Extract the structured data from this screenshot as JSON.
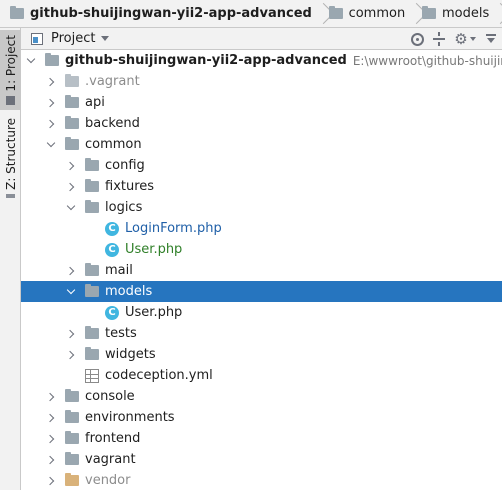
{
  "breadcrumb": {
    "items": [
      {
        "label": "github-shuijingwan-yii2-app-advanced",
        "bold": true
      },
      {
        "label": "common",
        "bold": false
      },
      {
        "label": "models",
        "bold": false
      }
    ]
  },
  "side_tabs": {
    "project": "1: Project",
    "structure": "Z: Structure"
  },
  "tool_window": {
    "view_label": "Project",
    "actions": [
      "locate-target",
      "collapse-all",
      "settings",
      "hide"
    ]
  },
  "tree": [
    {
      "label": "github-shuijingwan-yii2-app-advanced",
      "path": "E:\\wwwroot\\github-shuijingwan-",
      "depth": 0,
      "expanded": true,
      "icon": "folder",
      "style": "root"
    },
    {
      "label": ".vagrant",
      "depth": 1,
      "expanded": false,
      "icon": "folder-dim",
      "style": "dim"
    },
    {
      "label": "api",
      "depth": 1,
      "expanded": false,
      "icon": "folder",
      "style": "normal"
    },
    {
      "label": "backend",
      "depth": 1,
      "expanded": false,
      "icon": "folder",
      "style": "normal"
    },
    {
      "label": "common",
      "depth": 1,
      "expanded": true,
      "icon": "folder",
      "style": "normal"
    },
    {
      "label": "config",
      "depth": 2,
      "expanded": false,
      "icon": "folder",
      "style": "normal"
    },
    {
      "label": "fixtures",
      "depth": 2,
      "expanded": false,
      "icon": "folder",
      "style": "normal"
    },
    {
      "label": "logics",
      "depth": 2,
      "expanded": true,
      "icon": "folder",
      "style": "normal"
    },
    {
      "label": "LoginForm.php",
      "depth": 3,
      "expanded": null,
      "icon": "php-class",
      "style": "blue"
    },
    {
      "label": "User.php",
      "depth": 3,
      "expanded": null,
      "icon": "php-class",
      "style": "green"
    },
    {
      "label": "mail",
      "depth": 2,
      "expanded": false,
      "icon": "folder",
      "style": "normal"
    },
    {
      "label": "models",
      "depth": 2,
      "expanded": true,
      "icon": "folder",
      "style": "normal",
      "selected": true
    },
    {
      "label": "User.php",
      "depth": 3,
      "expanded": null,
      "icon": "php-class",
      "style": "normal"
    },
    {
      "label": "tests",
      "depth": 2,
      "expanded": false,
      "icon": "folder",
      "style": "normal"
    },
    {
      "label": "widgets",
      "depth": 2,
      "expanded": false,
      "icon": "folder",
      "style": "normal"
    },
    {
      "label": "codeception.yml",
      "depth": 2,
      "expanded": null,
      "icon": "yml-file",
      "style": "normal"
    },
    {
      "label": "console",
      "depth": 1,
      "expanded": false,
      "icon": "folder",
      "style": "normal"
    },
    {
      "label": "environments",
      "depth": 1,
      "expanded": false,
      "icon": "folder",
      "style": "normal"
    },
    {
      "label": "frontend",
      "depth": 1,
      "expanded": false,
      "icon": "folder",
      "style": "normal"
    },
    {
      "label": "vagrant",
      "depth": 1,
      "expanded": false,
      "icon": "folder",
      "style": "normal"
    },
    {
      "label": "vendor",
      "depth": 1,
      "expanded": false,
      "icon": "folder-excluded",
      "style": "dim"
    }
  ],
  "colors": {
    "selection": "#2675bf",
    "php_class_icon": "#40b6e0",
    "modified_file": "#2060a8",
    "added_file": "#2f7f28"
  }
}
